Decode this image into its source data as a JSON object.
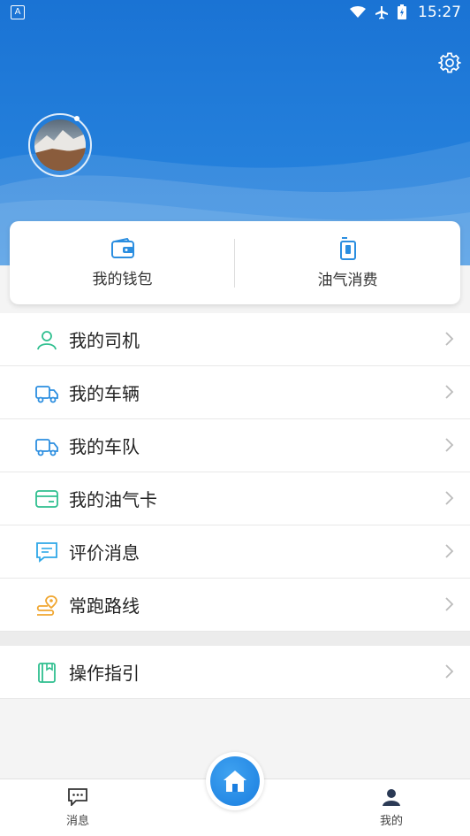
{
  "status_bar": {
    "time": "15:27",
    "notification_glyph": "A"
  },
  "header": {
    "settings_icon": "gear-icon",
    "avatar_alt": ""
  },
  "quick_actions": [
    {
      "label": "我的钱包",
      "icon": "wallet-icon"
    },
    {
      "label": "油气消费",
      "icon": "fuel-icon"
    }
  ],
  "menu": [
    {
      "label": "我的司机",
      "icon": "driver-icon",
      "color": "#2fbf8f"
    },
    {
      "label": "我的车辆",
      "icon": "truck-icon",
      "color": "#2b8ee0"
    },
    {
      "label": "我的车队",
      "icon": "fleet-icon",
      "color": "#2b8ee0"
    },
    {
      "label": "我的油气卡",
      "icon": "card-icon",
      "color": "#2fbf8f"
    },
    {
      "label": "评价消息",
      "icon": "message-icon",
      "color": "#2fa8e8"
    },
    {
      "label": "常跑路线",
      "icon": "route-icon",
      "color": "#f0a630"
    }
  ],
  "menu2": [
    {
      "label": "操作指引",
      "icon": "guide-book-icon",
      "color": "#2fbf8f"
    }
  ],
  "tabbar": {
    "messages_label": "消息",
    "mine_label": "我的"
  },
  "colors": {
    "brand": "#1a73d4",
    "accent_green": "#2fbf8f",
    "accent_orange": "#f0a630"
  }
}
